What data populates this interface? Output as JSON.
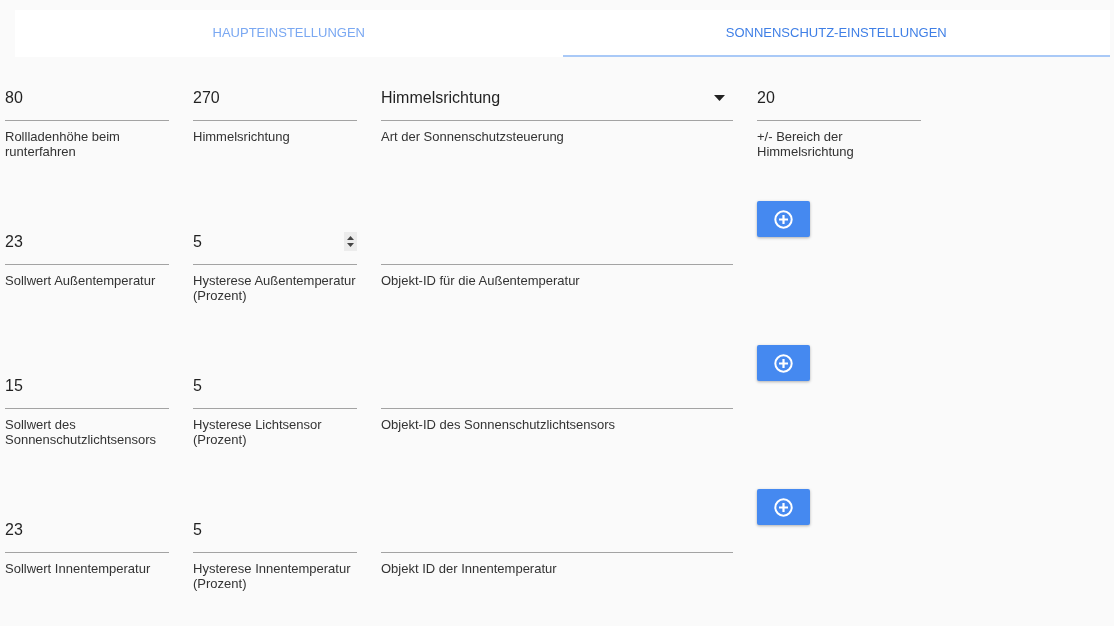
{
  "tabs": [
    {
      "label": "HAUPTEINSTELLUNGEN",
      "selected": false
    },
    {
      "label": "SONNENSCHUTZ-EINSTELLUNGEN",
      "selected": true
    }
  ],
  "rows": [
    {
      "fields": [
        {
          "kind": "number",
          "value": "80",
          "label": "Rollladenhöhe beim runterfahren",
          "hovered": false
        },
        {
          "kind": "number",
          "value": "270",
          "label": "Himmelsrichtung",
          "hovered": false
        },
        {
          "kind": "select",
          "value": "Himmelsrichtung",
          "label": "Art der Sonnenschutzsteuerung"
        },
        {
          "kind": "number",
          "value": "20",
          "label": "+/- Bereich der Himmelsrichtung",
          "hovered": false
        }
      ]
    },
    {
      "fields": [
        {
          "kind": "number",
          "value": "23",
          "label": "Sollwert Außentemperatur",
          "hovered": false
        },
        {
          "kind": "number",
          "value": "5",
          "label": "Hysterese Außentemperatur (Prozent)",
          "hovered": true
        },
        {
          "kind": "text",
          "label": "Objekt-ID für die Außentemperatur"
        },
        {
          "kind": "add_button"
        }
      ]
    },
    {
      "fields": [
        {
          "kind": "number",
          "value": "15",
          "label": "Sollwert des Sonnenschutzlichtsensors",
          "hovered": false
        },
        {
          "kind": "number",
          "value": "5",
          "label": "Hysterese Lichtsensor (Prozent)",
          "hovered": false
        },
        {
          "kind": "text",
          "label": "Objekt-ID des Sonnenschutzlichtsensors"
        },
        {
          "kind": "add_button"
        }
      ]
    },
    {
      "fields": [
        {
          "kind": "number",
          "value": "23",
          "label": "Sollwert Innentemperatur",
          "hovered": false
        },
        {
          "kind": "number",
          "value": "5",
          "label": "Hysterese Innentemperatur (Prozent)",
          "hovered": false
        },
        {
          "kind": "text",
          "label": "Objekt ID der Innentemperatur"
        },
        {
          "kind": "add_button"
        }
      ]
    }
  ]
}
